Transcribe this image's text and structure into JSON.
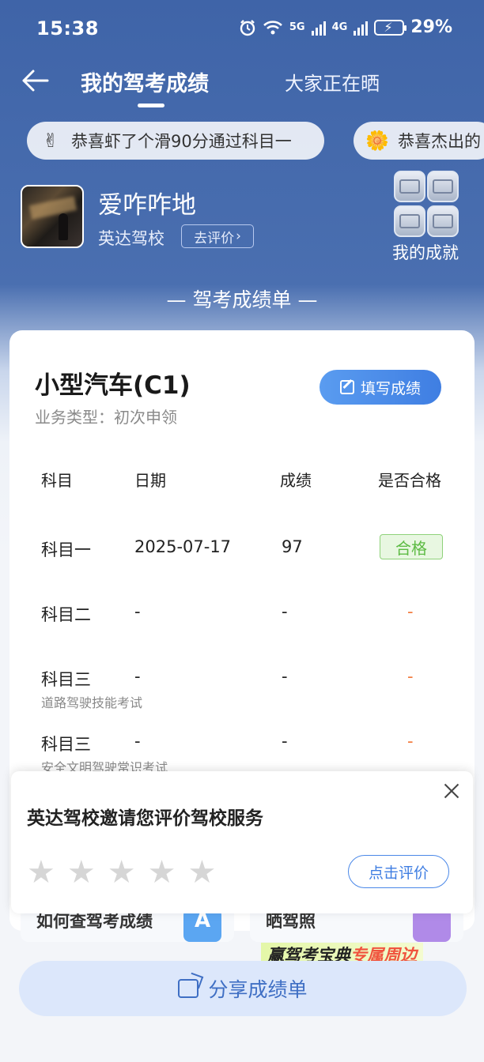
{
  "status": {
    "time": "15:38",
    "net1": "5G",
    "net2": "4G",
    "battery": "29%"
  },
  "nav": {
    "tab_mine": "我的驾考成绩",
    "tab_share": "大家正在晒"
  },
  "tickers": [
    {
      "emoji": "✌",
      "text": "恭喜虾了个滑90分通过科目一"
    },
    {
      "emoji": "🌼",
      "text": "恭喜杰出的"
    }
  ],
  "profile": {
    "username": "爱咋咋地",
    "school": "英达驾校",
    "review_label": "去评价",
    "achievements_label": "我的成就"
  },
  "section_title": "— 驾考成绩单 —",
  "card": {
    "car_type": "小型汽车(C1)",
    "biz_type": "业务类型：初次申领",
    "fill_button": "填写成绩",
    "headers": {
      "subject": "科目",
      "date": "日期",
      "score": "成绩",
      "pass": "是否合格"
    },
    "rows": [
      {
        "subject": "科目一",
        "sub": "",
        "date": "2025-07-17",
        "score": "97",
        "pass": "合格"
      },
      {
        "subject": "科目二",
        "sub": "",
        "date": "-",
        "score": "-",
        "pass": "-"
      },
      {
        "subject": "科目三",
        "sub": "道路驾驶技能考试",
        "date": "-",
        "score": "-",
        "pass": "-"
      },
      {
        "subject": "科目三",
        "sub": "安全文明驾驶常识考试",
        "date": "-",
        "score": "-",
        "pass": "-"
      }
    ]
  },
  "promos": {
    "left": "如何查驾考成绩",
    "right": "晒驾照",
    "banner_a": "赢驾考宝典",
    "banner_b": "专属周边"
  },
  "share_button": "分享成绩单",
  "popup": {
    "title": "英达驾校邀请您评价驾校服务",
    "rate_button": "点击评价",
    "stars": 5,
    "rating": 0
  },
  "colors": {
    "header_bg": "#3f64a8",
    "accent": "#3f7ee2",
    "pass_green": "#5dbb44",
    "dash_orange": "#f27a3d"
  }
}
